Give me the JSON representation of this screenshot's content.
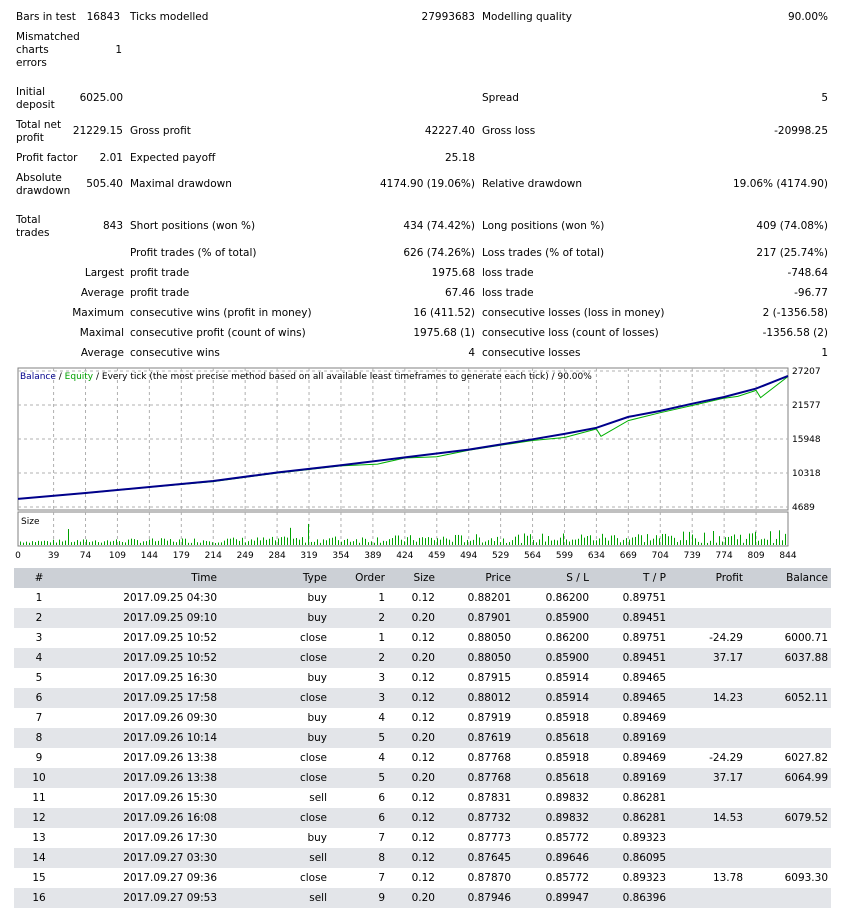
{
  "summary": {
    "bars_in_test": {
      "label": "Bars in test",
      "value": "16843"
    },
    "ticks_modelled": {
      "label": "Ticks modelled",
      "value": "27993683"
    },
    "modelling_quality": {
      "label": "Modelling quality",
      "value": "90.00%"
    },
    "mismatched": {
      "label": "Mismatched charts errors",
      "value": "1"
    },
    "initial_deposit": {
      "label": "Initial deposit",
      "value": "6025.00"
    },
    "spread": {
      "label": "Spread",
      "value": "5"
    },
    "total_net_profit": {
      "label": "Total net profit",
      "value": "21229.15"
    },
    "gross_profit": {
      "label": "Gross profit",
      "value": "42227.40"
    },
    "gross_loss": {
      "label": "Gross loss",
      "value": "-20998.25"
    },
    "profit_factor": {
      "label": "Profit factor",
      "value": "2.01"
    },
    "expected_payoff": {
      "label": "Expected payoff",
      "value": "25.18"
    },
    "absolute_drawdown": {
      "label": "Absolute drawdown",
      "value": "505.40"
    },
    "maximal_drawdown": {
      "label": "Maximal drawdown",
      "value": "4174.90 (19.06%)"
    },
    "relative_drawdown": {
      "label": "Relative drawdown",
      "value": "19.06% (4174.90)"
    },
    "total_trades": {
      "label": "Total trades",
      "value": "843"
    },
    "short_positions": {
      "label": "Short positions (won %)",
      "value": "434 (74.42%)"
    },
    "long_positions": {
      "label": "Long positions (won %)",
      "value": "409 (74.08%)"
    },
    "profit_trades": {
      "label": "Profit trades (% of total)",
      "value": "626 (74.26%)"
    },
    "loss_trades": {
      "label": "Loss trades (% of total)",
      "value": "217 (25.74%)"
    },
    "rows": [
      {
        "prefix": "Largest",
        "label1": "profit trade",
        "value1": "1975.68",
        "label2": "loss trade",
        "value2": "-748.64"
      },
      {
        "prefix": "Average",
        "label1": "profit trade",
        "value1": "67.46",
        "label2": "loss trade",
        "value2": "-96.77"
      },
      {
        "prefix": "Maximum",
        "label1": "consecutive wins (profit in money)",
        "value1": "16 (411.52)",
        "label2": "consecutive losses (loss in money)",
        "value2": "2 (-1356.58)"
      },
      {
        "prefix": "Maximal",
        "label1": "consecutive profit (count of wins)",
        "value1": "1975.68 (1)",
        "label2": "consecutive loss (count of losses)",
        "value2": "-1356.58 (2)"
      },
      {
        "prefix": "Average",
        "label1": "consecutive wins",
        "value1": "4",
        "label2": "consecutive losses",
        "value2": "1"
      }
    ]
  },
  "chart": {
    "legend_balance": "Balance",
    "legend_sep": " / ",
    "legend_equity": "Equity",
    "legend_rest": " / Every tick (the most precise method based on all available least timeframes to generate each tick) / 90.00%",
    "size_label": "Size",
    "y_ticks": [
      "27207",
      "21577",
      "15948",
      "10318",
      "4689"
    ],
    "x_ticks": [
      "0",
      "39",
      "74",
      "109",
      "144",
      "179",
      "214",
      "249",
      "284",
      "319",
      "354",
      "389",
      "424",
      "459",
      "494",
      "529",
      "564",
      "599",
      "634",
      "669",
      "704",
      "739",
      "774",
      "809",
      "844"
    ],
    "colors": {
      "balance": "#00008b",
      "equity": "#00b000",
      "size": "#00a000",
      "grid": "#b0b0b0"
    }
  },
  "chart_data": {
    "type": "line",
    "title": "Every tick (the most precise method based on all available least timeframes to generate each tick) / 90.00%",
    "xlabel": "",
    "ylabel": "",
    "xlim": [
      0,
      844
    ],
    "ylim": [
      4689,
      27207
    ],
    "grid": true,
    "legend": "top-left",
    "series": [
      {
        "name": "Balance",
        "x": [
          0,
          74,
          144,
          214,
          284,
          354,
          424,
          494,
          564,
          599,
          634,
          669,
          704,
          739,
          774,
          809,
          844
        ],
        "values": [
          6025,
          7000,
          8000,
          9000,
          10400,
          11600,
          12900,
          14200,
          15900,
          16800,
          17800,
          19600,
          20600,
          21800,
          22900,
          24300,
          26400
        ]
      },
      {
        "name": "Equity",
        "x": [
          0,
          74,
          144,
          214,
          284,
          354,
          394,
          424,
          459,
          494,
          529,
          564,
          599,
          634,
          639,
          669,
          704,
          739,
          774,
          789,
          809,
          814,
          844
        ],
        "values": [
          6025,
          6950,
          7950,
          8900,
          10300,
          11500,
          11800,
          12800,
          13000,
          14100,
          14900,
          15700,
          16200,
          17600,
          16400,
          19000,
          20300,
          21500,
          22700,
          23000,
          24000,
          22800,
          26300
        ]
      }
    ],
    "size_bars_note": "Size histogram shown below main chart"
  },
  "table": {
    "headers": [
      "#",
      "Time",
      "Type",
      "Order",
      "Size",
      "Price",
      "S / L",
      "T / P",
      "Profit",
      "Balance"
    ],
    "rows": [
      [
        "1",
        "2017.09.25 04:30",
        "buy",
        "1",
        "0.12",
        "0.88201",
        "0.86200",
        "0.89751",
        "",
        ""
      ],
      [
        "2",
        "2017.09.25 09:10",
        "buy",
        "2",
        "0.20",
        "0.87901",
        "0.85900",
        "0.89451",
        "",
        ""
      ],
      [
        "3",
        "2017.09.25 10:52",
        "close",
        "1",
        "0.12",
        "0.88050",
        "0.86200",
        "0.89751",
        "-24.29",
        "6000.71"
      ],
      [
        "4",
        "2017.09.25 10:52",
        "close",
        "2",
        "0.20",
        "0.88050",
        "0.85900",
        "0.89451",
        "37.17",
        "6037.88"
      ],
      [
        "5",
        "2017.09.25 16:30",
        "buy",
        "3",
        "0.12",
        "0.87915",
        "0.85914",
        "0.89465",
        "",
        ""
      ],
      [
        "6",
        "2017.09.25 17:58",
        "close",
        "3",
        "0.12",
        "0.88012",
        "0.85914",
        "0.89465",
        "14.23",
        "6052.11"
      ],
      [
        "7",
        "2017.09.26 09:30",
        "buy",
        "4",
        "0.12",
        "0.87919",
        "0.85918",
        "0.89469",
        "",
        ""
      ],
      [
        "8",
        "2017.09.26 10:14",
        "buy",
        "5",
        "0.20",
        "0.87619",
        "0.85618",
        "0.89169",
        "",
        ""
      ],
      [
        "9",
        "2017.09.26 13:38",
        "close",
        "4",
        "0.12",
        "0.87768",
        "0.85918",
        "0.89469",
        "-24.29",
        "6027.82"
      ],
      [
        "10",
        "2017.09.26 13:38",
        "close",
        "5",
        "0.20",
        "0.87768",
        "0.85618",
        "0.89169",
        "37.17",
        "6064.99"
      ],
      [
        "11",
        "2017.09.26 15:30",
        "sell",
        "6",
        "0.12",
        "0.87831",
        "0.89832",
        "0.86281",
        "",
        ""
      ],
      [
        "12",
        "2017.09.26 16:08",
        "close",
        "6",
        "0.12",
        "0.87732",
        "0.89832",
        "0.86281",
        "14.53",
        "6079.52"
      ],
      [
        "13",
        "2017.09.26 17:30",
        "buy",
        "7",
        "0.12",
        "0.87773",
        "0.85772",
        "0.89323",
        "",
        ""
      ],
      [
        "14",
        "2017.09.27 03:30",
        "sell",
        "8",
        "0.12",
        "0.87645",
        "0.89646",
        "0.86095",
        "",
        ""
      ],
      [
        "15",
        "2017.09.27 09:36",
        "close",
        "7",
        "0.12",
        "0.87870",
        "0.85772",
        "0.89323",
        "13.78",
        "6093.30"
      ],
      [
        "16",
        "2017.09.27 09:53",
        "sell",
        "9",
        "0.20",
        "0.87946",
        "0.89947",
        "0.86396",
        "",
        ""
      ]
    ]
  }
}
